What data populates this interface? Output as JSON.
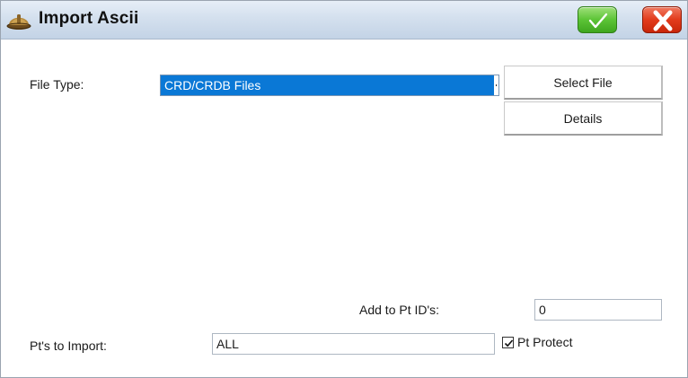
{
  "window": {
    "title": "Import Ascii",
    "icon": "hardhat-icon",
    "ok_icon": "checkmark-icon",
    "close_icon": "x-icon",
    "colors": {
      "ok": "#4cb52a",
      "close": "#d9311a",
      "selection": "#0a78d6"
    }
  },
  "file_type": {
    "label": "File Type:",
    "selected": "CRD/CRDB Files"
  },
  "buttons": {
    "select_file": "Select File",
    "details": "Details"
  },
  "add_to_pt_ids": {
    "label": "Add to Pt ID's:",
    "value": "0"
  },
  "pts_to_import": {
    "label": "Pt's to Import:",
    "value": "ALL"
  },
  "pt_protect": {
    "label": "Pt Protect",
    "checked": true
  }
}
